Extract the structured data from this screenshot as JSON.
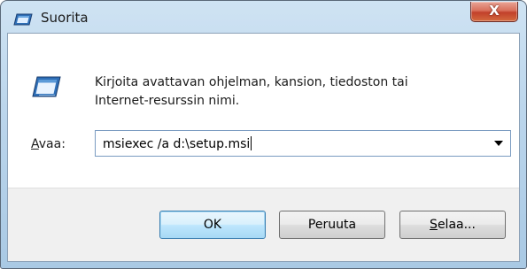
{
  "window": {
    "title": "Suorita",
    "close_glyph": "X"
  },
  "dialog": {
    "description_line1": "Kirjoita avattavan ohjelman, kansion, tiedoston tai",
    "description_line2": "Internet-resurssin nimi.",
    "open_label_accel": "A",
    "open_label_rest": "vaa:",
    "command_value": "msiexec /a d:\\setup.msi"
  },
  "buttons": {
    "ok": "OK",
    "cancel": "Peruuta",
    "browse_accel": "S",
    "browse_rest": "elaa..."
  },
  "icons": {
    "title_icon": "run-icon",
    "dialog_icon": "run-icon",
    "dropdown": "chevron-down-icon"
  },
  "colors": {
    "titlebar": "#bcd6ec",
    "close_button": "#c1402a",
    "footer": "#f0f0f0",
    "default_button_border": "#3c7fb1"
  }
}
